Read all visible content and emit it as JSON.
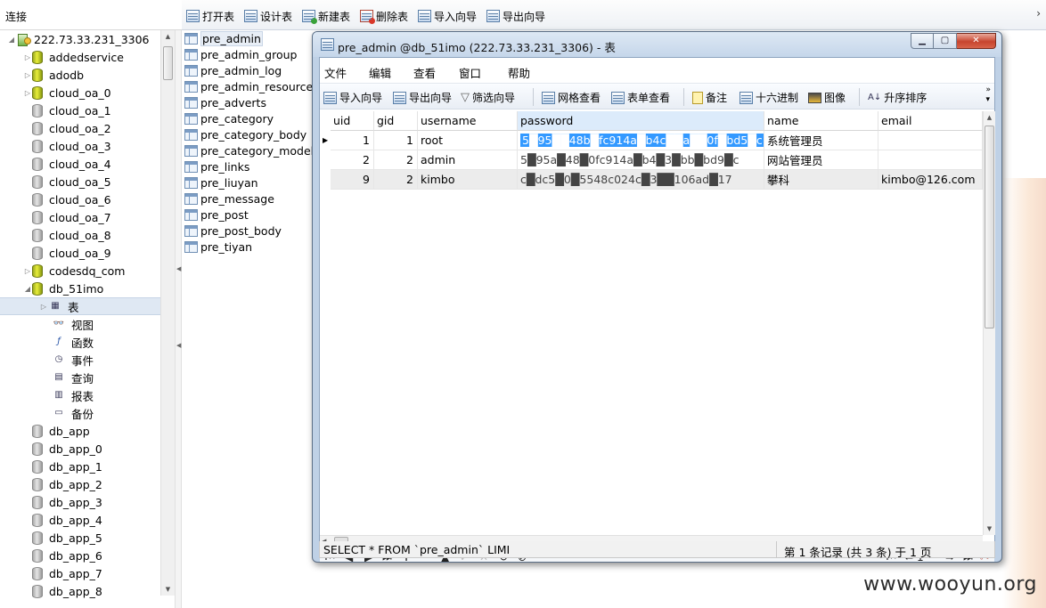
{
  "connection_header": "连接",
  "main_toolbar": [
    {
      "label": "打开表",
      "icon": "table-open-icon"
    },
    {
      "label": "设计表",
      "icon": "table-design-icon"
    },
    {
      "label": "新建表",
      "icon": "table-new-icon"
    },
    {
      "label": "删除表",
      "icon": "table-delete-icon"
    },
    {
      "label": "导入向导",
      "icon": "import-wizard-icon"
    },
    {
      "label": "导出向导",
      "icon": "export-wizard-icon"
    }
  ],
  "tree": {
    "server": "222.73.33.231_3306",
    "databases_top": [
      "addedservice",
      "adodb",
      "cloud_oa_0",
      "cloud_oa_1",
      "cloud_oa_2",
      "cloud_oa_3",
      "cloud_oa_4",
      "cloud_oa_5",
      "cloud_oa_6",
      "cloud_oa_7",
      "cloud_oa_8",
      "cloud_oa_9",
      "codesdq_com"
    ],
    "open_db": "db_51imo",
    "sub_items": [
      "表",
      "视图",
      "函数",
      "事件",
      "查询",
      "报表",
      "备份"
    ],
    "databases_bottom": [
      "db_app",
      "db_app_0",
      "db_app_1",
      "db_app_2",
      "db_app_3",
      "db_app_4",
      "db_app_5",
      "db_app_6",
      "db_app_7",
      "db_app_8"
    ]
  },
  "tables": [
    "pre_admin",
    "pre_admin_group",
    "pre_admin_log",
    "pre_admin_resource",
    "pre_adverts",
    "pre_category",
    "pre_category_body",
    "pre_category_model",
    "pre_links",
    "pre_liuyan",
    "pre_message",
    "pre_post",
    "pre_post_body",
    "pre_tiyan"
  ],
  "window": {
    "title": "pre_admin @db_51imo (222.73.33.231_3306) - 表",
    "menu": [
      "文件",
      "编辑",
      "查看",
      "窗口",
      "帮助"
    ],
    "toolbar": [
      {
        "label": "导入向导",
        "icon": "import-wizard-icon"
      },
      {
        "label": "导出向导",
        "icon": "export-wizard-icon"
      },
      {
        "label": "筛选向导",
        "icon": "filter-icon"
      },
      {
        "label": "网格查看",
        "icon": "grid-view-icon"
      },
      {
        "label": "表单查看",
        "icon": "form-view-icon"
      },
      {
        "label": "备注",
        "icon": "note-icon"
      },
      {
        "label": "十六进制",
        "icon": "hex-icon"
      },
      {
        "label": "图像",
        "icon": "image-icon"
      },
      {
        "label": "升序排序",
        "icon": "sort-asc-icon"
      }
    ],
    "columns": [
      "uid",
      "gid",
      "username",
      "password",
      "name",
      "email"
    ],
    "rows": [
      {
        "uid": "1",
        "gid": "1",
        "username": "root",
        "password": "5█95██48b█fc914a█b4c██a██0f█bd5█c",
        "name": "系统管理员",
        "email": ""
      },
      {
        "uid": "2",
        "gid": "2",
        "username": "admin",
        "password": "5█95a█48█0fc914a█b4█3█bb█bd9█c",
        "name": "网站管理员",
        "email": ""
      },
      {
        "uid": "9",
        "gid": "2",
        "username": "kimbo",
        "password": "c█dc5█0█5548c024c█3██106ad█17",
        "name": "攀科",
        "email": "kimbo@126.com"
      }
    ],
    "page_input": "1",
    "sql_text": "SELECT * FROM `pre_admin` LIMI",
    "record_text": "第 1 条记录 (共 3 条) 于 1 页"
  },
  "watermark": "www.wooyun.org",
  "colors": {
    "selection": "#3399ff",
    "window_frame": "#bfd1e6",
    "header_highlight": "#dcebfb"
  }
}
